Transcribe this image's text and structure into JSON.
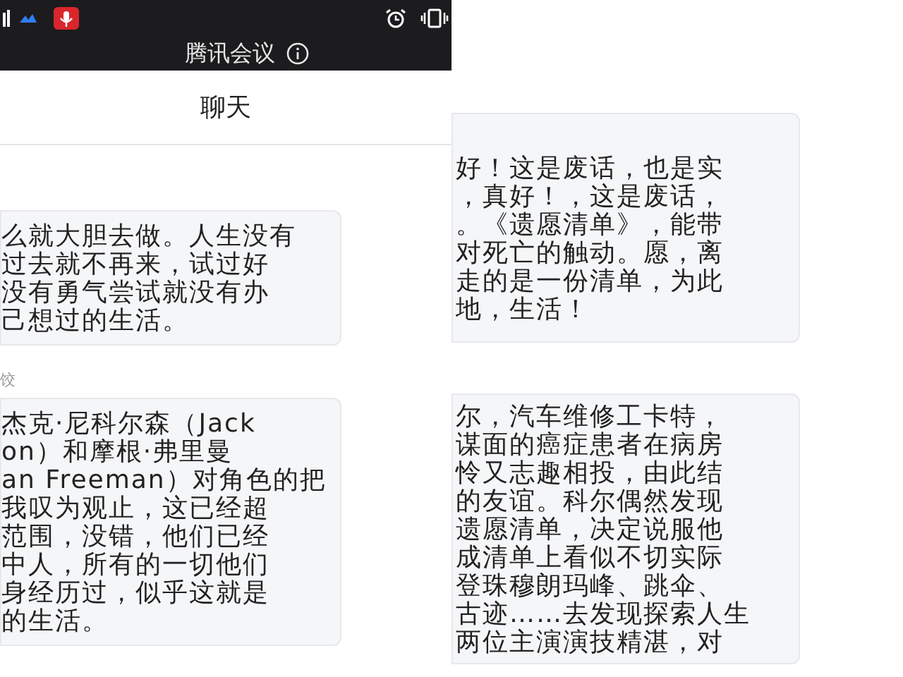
{
  "app_title": "腾讯会议",
  "screen_title": "聊天",
  "left_messages": [
    {
      "lines": [
        "么就大胆去做。人生没有",
        "过去就不再来，试过好",
        "没有勇气尝试就没有办",
        "己想过的生活。"
      ]
    },
    {
      "sender": "饺",
      "lines": [
        "杰克·尼科尔森（Jack",
        "on）和摩根·弗里曼",
        "an Freeman）对角色的把",
        "我叹为观止，这已经超",
        "范围，没错，他们已经",
        "中人，所有的一切他们",
        "身经历过，似乎这就是",
        "的生活。"
      ]
    }
  ],
  "right_messages": [
    {
      "lines": [
        "好！这是废话，也是实",
        "，真好！，这是废话，",
        "。《遗愿清单》，能带",
        "对死亡的触动。愿，离",
        "走的是一份清单，为此",
        "地，生活！"
      ]
    },
    {
      "lines": [
        "尔，汽车维修工卡特，",
        "谋面的癌症患者在病房",
        "怜又志趣相投，由此结",
        "的友谊。科尔偶然发现",
        "遗愿清单，决定说服他",
        "成清单上看似不切实际",
        "登珠穆朗玛峰、跳伞、",
        "古迹……去发现探索人生",
        "两位主演演技精湛，对"
      ]
    }
  ]
}
